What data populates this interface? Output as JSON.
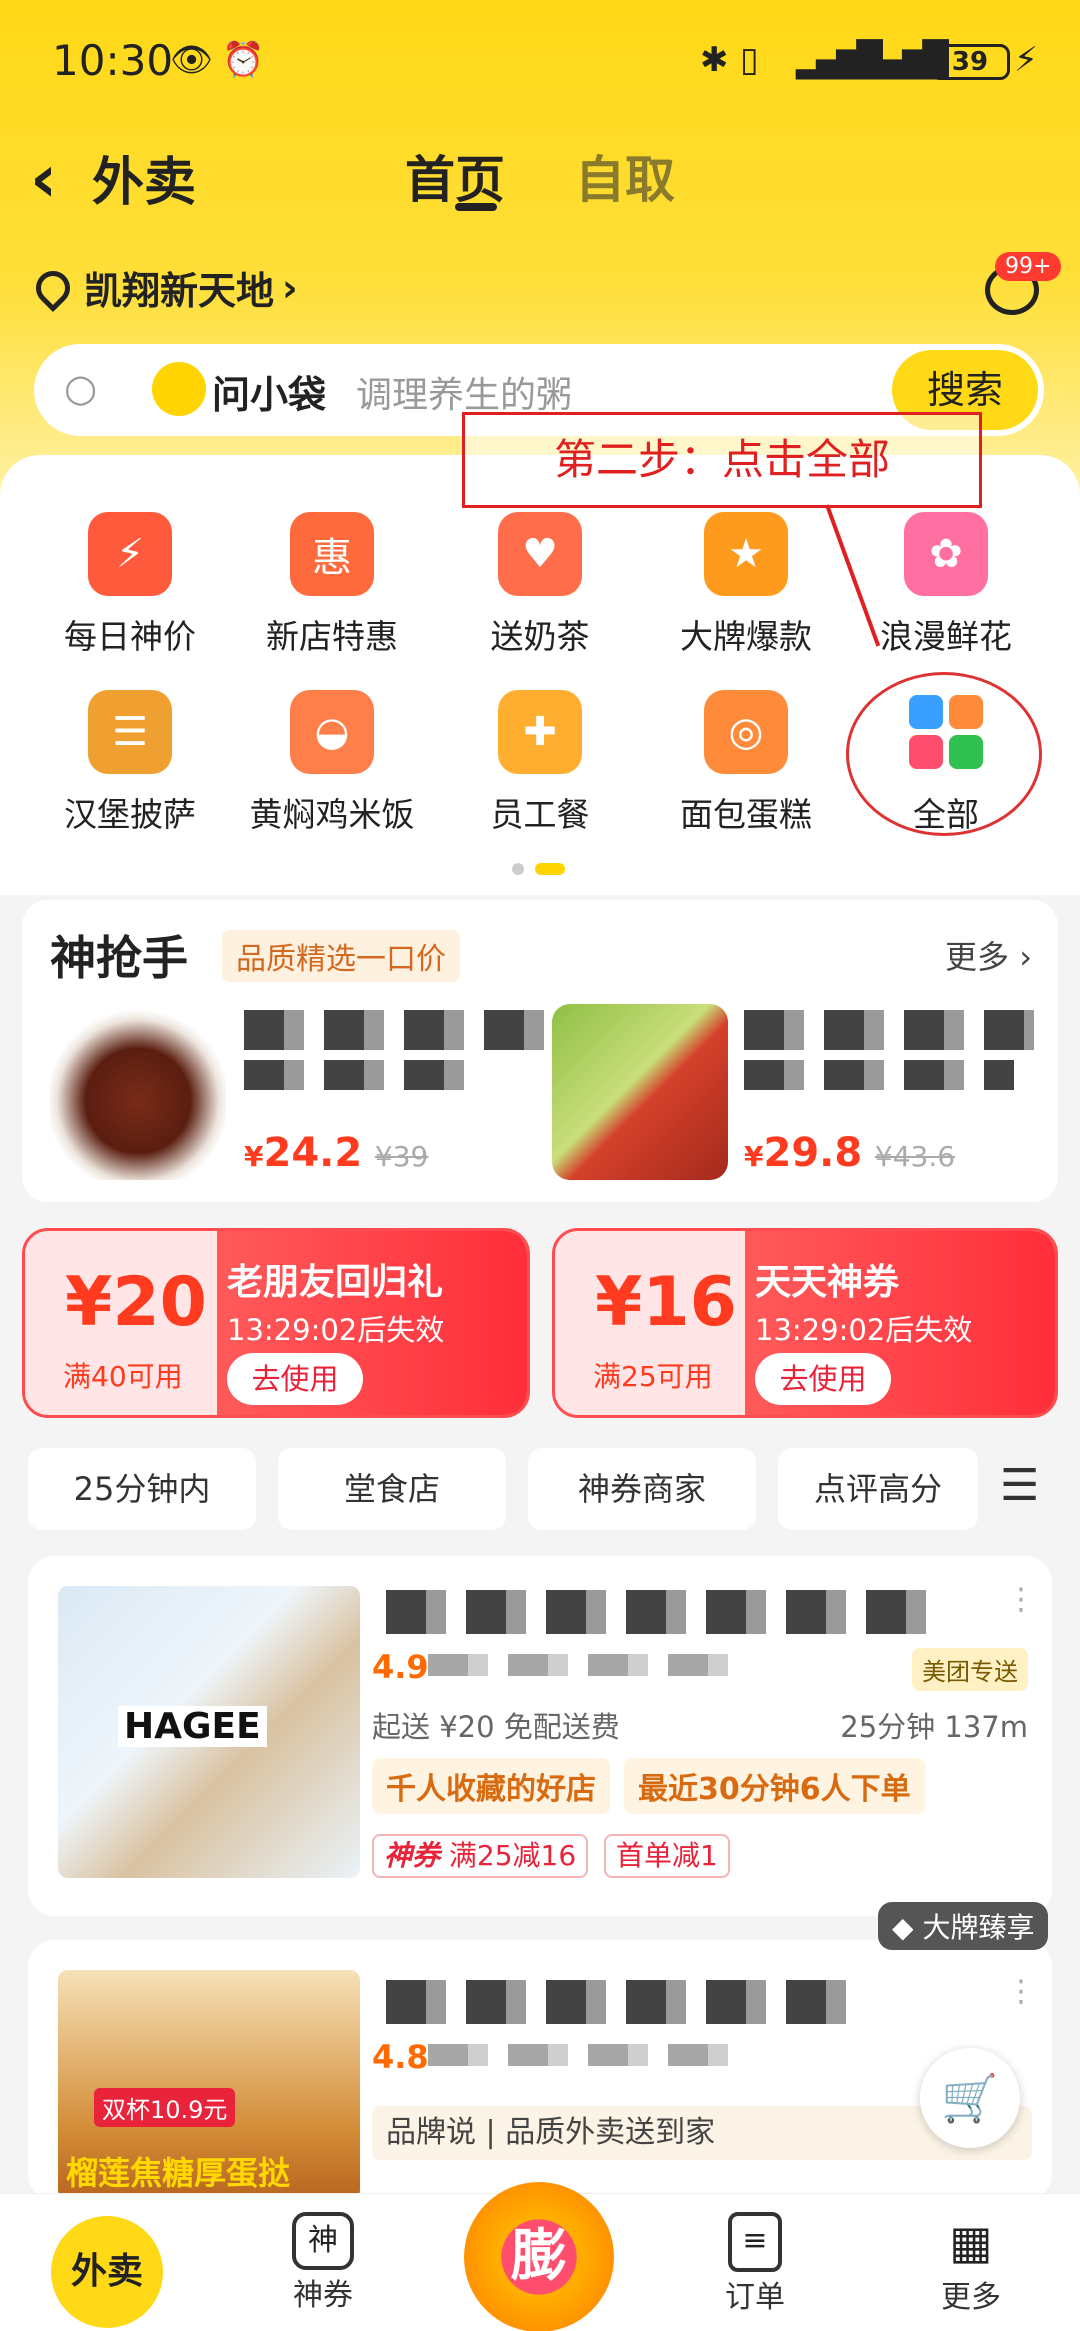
{
  "status": {
    "time": "10:30",
    "battery": "39"
  },
  "nav": {
    "back": "‹",
    "title": "外卖",
    "tabs": [
      {
        "label": "首页"
      },
      {
        "label": "自取"
      }
    ]
  },
  "location": {
    "name": "凯翔新天地",
    "arrow": "›",
    "unread": "99+"
  },
  "search": {
    "assistant": "问小袋",
    "placeholder": "调理养生的粥",
    "button": "搜索"
  },
  "annotation": "第二步：点击全部",
  "categories": [
    {
      "label": "每日神价",
      "icon": "lightning-icon",
      "color": "#ff5a3c"
    },
    {
      "label": "新店特惠",
      "icon": "hui-icon",
      "color": "#ff6a3d"
    },
    {
      "label": "送奶茶",
      "icon": "gift-icon",
      "color": "#ff6d4a"
    },
    {
      "label": "大牌爆款",
      "icon": "star-icon",
      "color": "#ff9b1c"
    },
    {
      "label": "浪漫鲜花",
      "icon": "rose-icon",
      "color": "#ff6fa1"
    },
    {
      "label": "汉堡披萨",
      "icon": "burger-icon",
      "color": "#f0a030"
    },
    {
      "label": "黄焖鸡米饭",
      "icon": "chicken-bowl-icon",
      "color": "#ff7f4a"
    },
    {
      "label": "员工餐",
      "icon": "lunchbox-icon",
      "color": "#ffae30"
    },
    {
      "label": "面包蛋糕",
      "icon": "donut-icon",
      "color": "#ff8a3a"
    },
    {
      "label": "全部",
      "icon": "grid-icon",
      "color": "#ffffff"
    }
  ],
  "flash": {
    "title": "神抢手",
    "tag": "品质精选一口价",
    "more": "更多 ›",
    "items": [
      {
        "price_sym": "¥",
        "price": "24.2",
        "old": "¥39"
      },
      {
        "price_sym": "¥",
        "price": "29.8",
        "old": "¥43.6"
      }
    ]
  },
  "coupons": [
    {
      "amount": "¥20",
      "cond": "满40可用",
      "title": "老朋友回归礼",
      "expire": "13:29:02后失效",
      "btn": "去使用"
    },
    {
      "amount": "¥16",
      "cond": "满25可用",
      "title": "天天神券",
      "expire": "13:29:02后失效",
      "btn": "去使用"
    }
  ],
  "filters": [
    "25分钟内",
    "堂食店",
    "神券商家",
    "点评高分"
  ],
  "stores": [
    {
      "rating": "4.9",
      "delivery_tag": "美团专送",
      "min": "起送 ¥20",
      "fee": "免配送费",
      "time": "25分钟",
      "dist": "137m",
      "highlights": [
        "千人收藏的好店",
        "最近30分钟6人下单"
      ],
      "promo_brand": "神券",
      "promo": "满25减16",
      "first": "首单减1",
      "image_text": "HAGEE"
    },
    {
      "rating": "4.8",
      "brand_badge": "大牌臻享",
      "brand_say": "品牌说",
      "brand_line": "品质外卖送到家",
      "image_caption": "榴莲焦糖厚蛋挞",
      "image_price": "双杯10.9元"
    }
  ],
  "bottom_nav": [
    {
      "label": "外卖"
    },
    {
      "label": "神券"
    },
    {
      "label": "膨"
    },
    {
      "label": "订单"
    },
    {
      "label": "更多"
    }
  ]
}
